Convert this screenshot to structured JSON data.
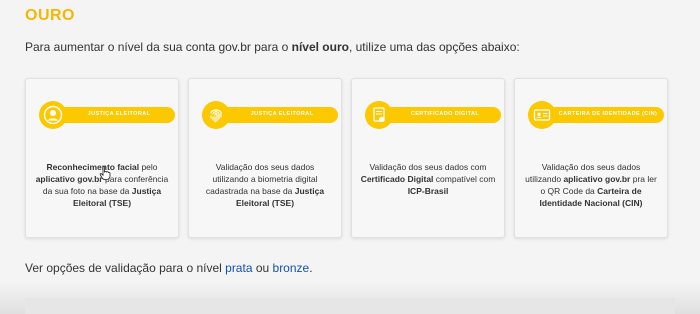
{
  "title": "OURO",
  "intro": {
    "part1": "Para aumentar o nível da sua conta gov.br para o ",
    "bold": "nível ouro",
    "part2": ", utilize uma das opções abaixo:"
  },
  "cards": [
    {
      "badge": "JUSTIÇA ELEITORAL",
      "icon": "face-icon",
      "desc": [
        {
          "b": "Reconhecimento facial",
          "t": " pelo "
        },
        {
          "b": "aplicativo gov.br",
          "t": " para conferência da sua foto na base da "
        },
        {
          "b": "Justiça Eleitoral (TSE)",
          "t": ""
        }
      ]
    },
    {
      "badge": "JUSTIÇA ELEITORAL",
      "icon": "fingerprint-icon",
      "desc": [
        {
          "b": "",
          "t": "Validação dos seus dados utilizando a biometria digital cadastrada na base da "
        },
        {
          "b": "Justiça Eleitoral (TSE)",
          "t": ""
        }
      ]
    },
    {
      "badge": "CERTIFICADO DIGITAL",
      "icon": "certificate-icon",
      "desc": [
        {
          "b": "",
          "t": "Validação dos seus dados com "
        },
        {
          "b": "Certificado Digital",
          "t": " compatível com "
        },
        {
          "b": "ICP-Brasil",
          "t": ""
        }
      ]
    },
    {
      "badge": "CARTEIRA DE IDENTIDADE (CIN)",
      "icon": "id-card-icon",
      "desc": [
        {
          "b": "",
          "t": "Validação dos seus dados utilizando "
        },
        {
          "b": "aplicativo gov.br",
          "t": " pra ler o QR Code da "
        },
        {
          "b": "Carteira de Identidade Nacional (CIN)",
          "t": ""
        }
      ]
    }
  ],
  "footer": {
    "text": "Ver opções de validação para o nível ",
    "link1": "prata",
    "middle": " ou ",
    "link2": "bronze",
    "end": "."
  },
  "colors": {
    "accent": "#fcc800",
    "title": "#f5b800",
    "link": "#1351b4"
  }
}
